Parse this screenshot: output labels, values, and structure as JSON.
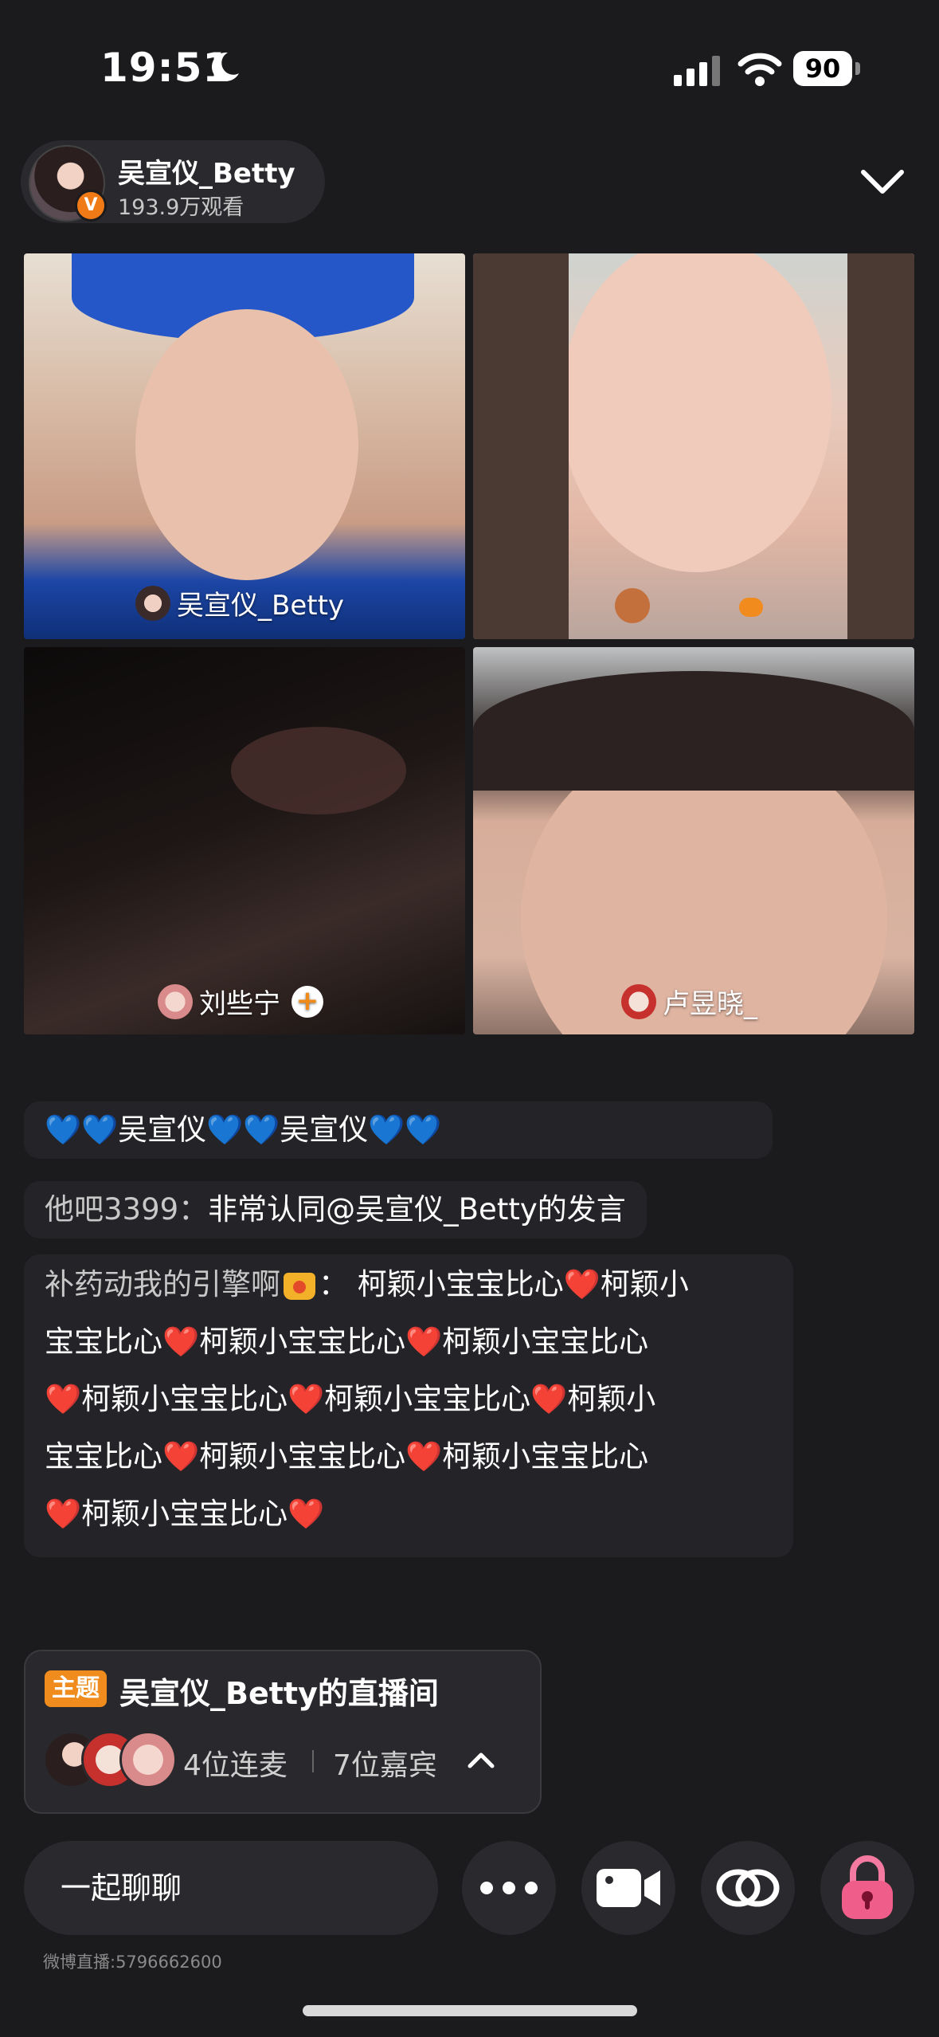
{
  "status_bar": {
    "time": "19:51",
    "battery": "90"
  },
  "header": {
    "host_name": "吴宣仪_Betty",
    "views": "193.9万观看",
    "badge": "V"
  },
  "tiles": [
    {
      "label": "吴宣仪_Betty"
    },
    {
      "label": ""
    },
    {
      "label": "刘些宁",
      "follow": "+"
    },
    {
      "label": "卢昱晓_"
    }
  ],
  "chat": {
    "msg1": {
      "text": "💙💙吴宣仪💙💙吴宣仪💙💙"
    },
    "msg2": {
      "nick": "他吧3399：",
      "text": "非常认同@吴宣仪_Betty的发言"
    },
    "msg3": {
      "nick": "补药动我的引擎啊",
      "lines": [
        "： 柯颖小宝宝比心❤️柯颖小",
        "宝宝比心❤️柯颖小宝宝比心❤️柯颖小宝宝比心",
        "❤️柯颖小宝宝比心❤️柯颖小宝宝比心❤️柯颖小",
        "宝宝比心❤️柯颖小宝宝比心❤️柯颖小宝宝比心",
        "❤️柯颖小宝宝比心❤️"
      ]
    }
  },
  "topic": {
    "tag": "主题",
    "title": "吴宣仪_Betty的直播间",
    "linked": "4位连麦",
    "guests": "7位嘉宾"
  },
  "bottom_bar": {
    "chat_placeholder": "一起聊聊",
    "footer": "微博直播:5796662600"
  },
  "colors": {
    "background": "#1b1b1e",
    "accent": "#f08c1d",
    "chat_bubble": "#242428"
  }
}
